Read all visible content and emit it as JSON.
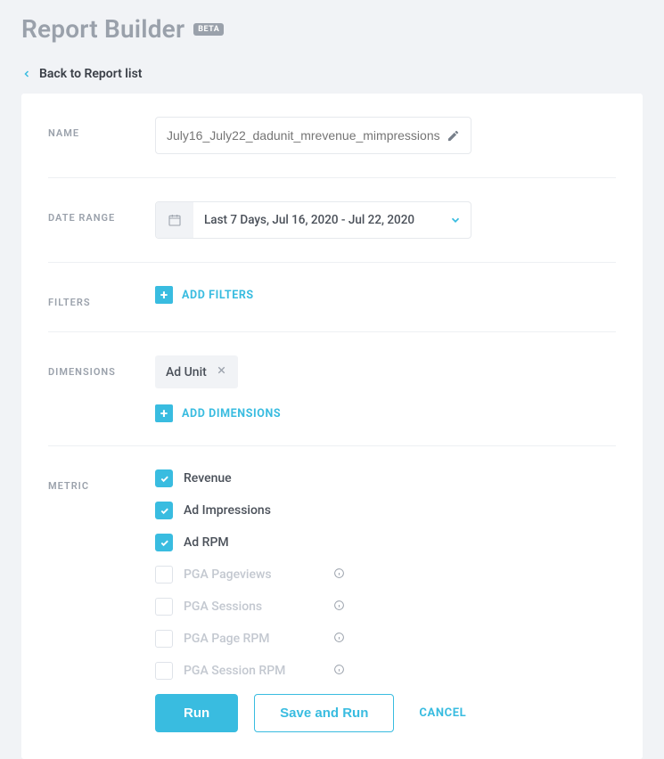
{
  "header": {
    "title": "Report Builder",
    "badge": "BETA",
    "back_label": "Back to Report list"
  },
  "form": {
    "name": {
      "label": "NAME",
      "placeholder": "July16_July22_dadunit_mrevenue_mimpressions"
    },
    "date_range": {
      "label": "DATE RANGE",
      "value": "Last 7 Days,  Jul 16, 2020 - Jul 22, 2020"
    },
    "filters": {
      "label": "FILTERS",
      "add": "ADD FILTERS"
    },
    "dimensions": {
      "label": "DIMENSIONS",
      "chip": "Ad Unit",
      "add": "ADD DIMENSIONS"
    },
    "metrics": {
      "label": "METRIC",
      "items": [
        {
          "label": "Revenue",
          "checked": true,
          "info": false
        },
        {
          "label": "Ad Impressions",
          "checked": true,
          "info": false
        },
        {
          "label": "Ad RPM",
          "checked": true,
          "info": false
        },
        {
          "label": "PGA Pageviews",
          "checked": false,
          "info": true
        },
        {
          "label": "PGA Sessions",
          "checked": false,
          "info": true
        },
        {
          "label": "PGA Page RPM",
          "checked": false,
          "info": true
        },
        {
          "label": "PGA Session RPM",
          "checked": false,
          "info": true
        }
      ]
    },
    "actions": {
      "run": "Run",
      "save_run": "Save and Run",
      "cancel": "CANCEL"
    }
  }
}
